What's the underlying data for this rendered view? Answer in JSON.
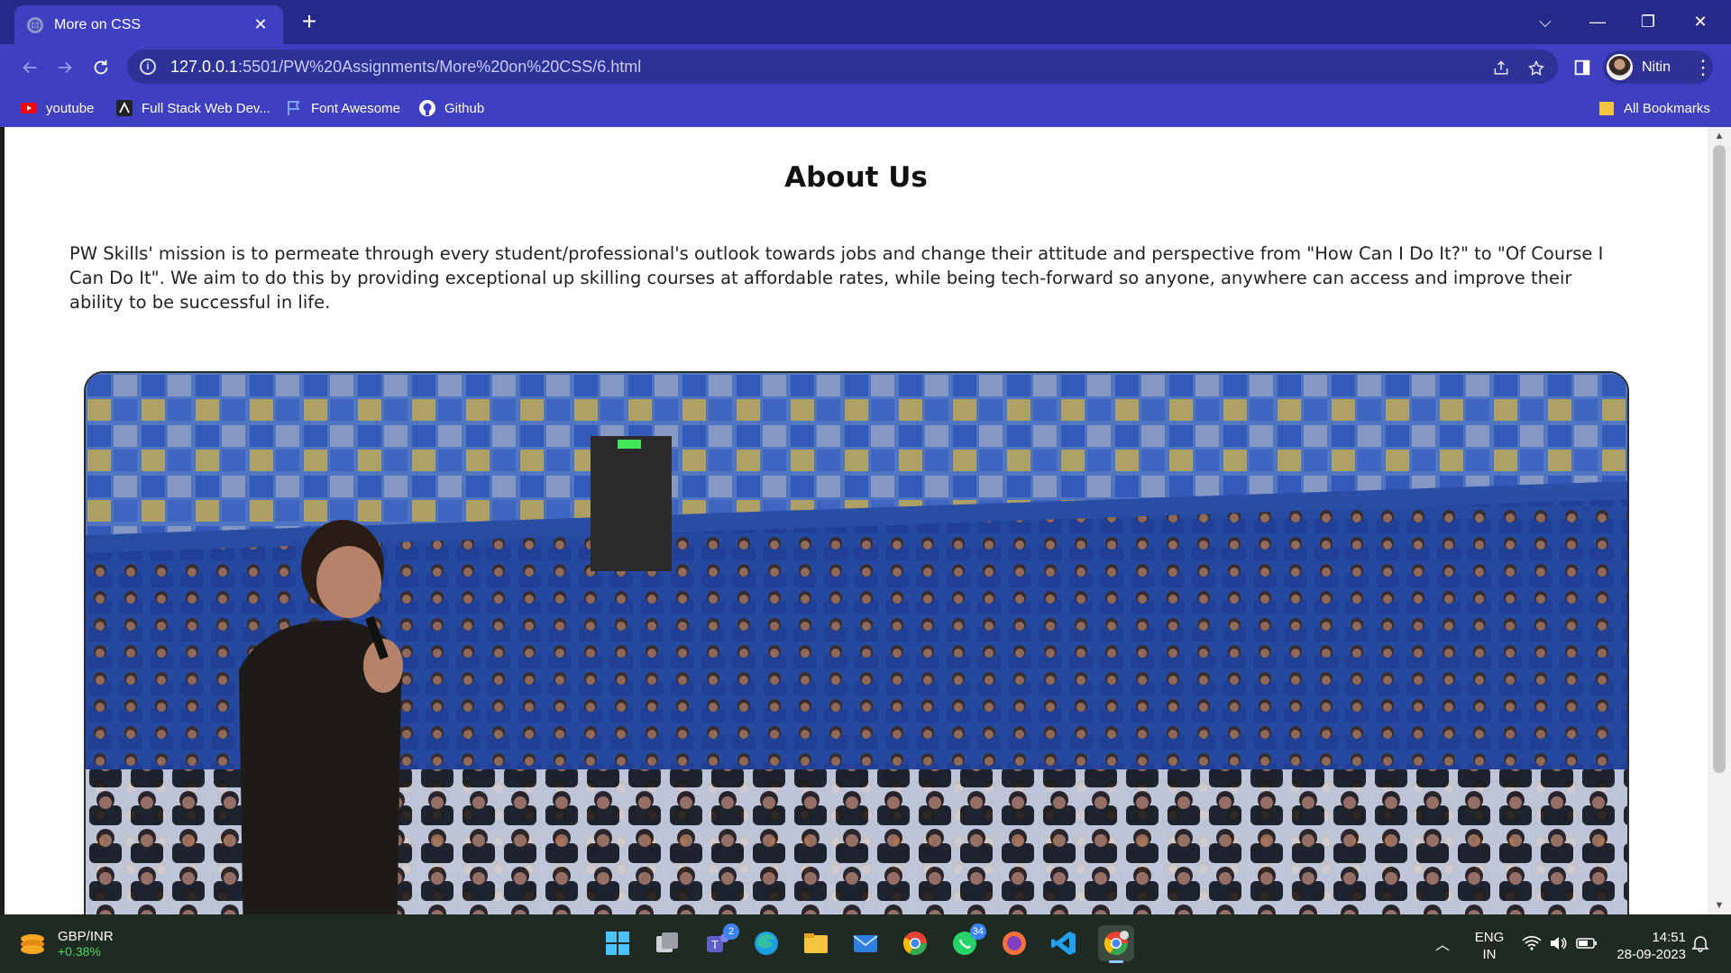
{
  "tab": {
    "title": "More on CSS"
  },
  "address": {
    "host": "127.0.0.1",
    "path": ":5501/PW%20Assignments/More%20on%20CSS/6.html"
  },
  "profile": {
    "name": "Nitin"
  },
  "bookmarks": [
    {
      "label": "youtube",
      "icon": "youtube-icon"
    },
    {
      "label": "Full Stack Web Dev...",
      "icon": "site-icon"
    },
    {
      "label": "Font Awesome",
      "icon": "flag-icon"
    },
    {
      "label": "Github",
      "icon": "github-icon"
    }
  ],
  "all_bookmarks": "All Bookmarks",
  "page": {
    "title": "About Us",
    "text": "PW Skills' mission is to permeate through every student/professional's outlook towards jobs and change their attitude and perspective from \"How Can I Do It?\" to \"Of Course I Can Do It\". We aim to do this by providing exceptional up skilling courses at affordable rates, while being tech-forward so anyone, anywhere can access and improve their ability to be successful in life."
  },
  "taskbar": {
    "widget_title": "GBP/INR",
    "widget_value": "+0.38%",
    "teams_badge": "2",
    "whatsapp_badge": "34",
    "lang_1": "ENG",
    "lang_2": "IN",
    "time": "14:51",
    "date": "28-09-2023"
  },
  "colors": {
    "chrome": "#3f3fc2",
    "tabstrip": "#252a8a",
    "taskbar": "#1f2a22"
  }
}
